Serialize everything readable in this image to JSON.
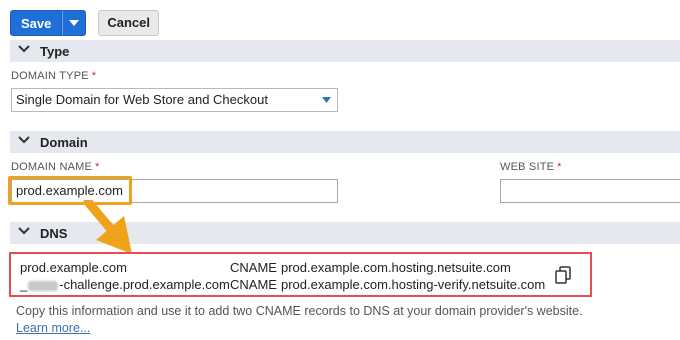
{
  "toolbar": {
    "save_label": "Save",
    "cancel_label": "Cancel"
  },
  "sections": {
    "type": "Type",
    "domain": "Domain",
    "dns": "DNS"
  },
  "type_section": {
    "domain_type_label": "DOMAIN TYPE",
    "required_mark": "*",
    "domain_type_value": "Single Domain for Web Store and Checkout"
  },
  "domain_section": {
    "domain_name_label": "DOMAIN NAME",
    "domain_name_value": "prod.example.com",
    "web_site_label": "WEB SITE",
    "web_site_value": ""
  },
  "dns_section": {
    "records": [
      {
        "host": "prod.example.com",
        "type": "CNAME",
        "target": "prod.example.com.hosting.netsuite.com"
      },
      {
        "host_prefix": "_",
        "host_suffix": "-challenge.prod.example.com",
        "type": "CNAME",
        "target": "prod.example.com.hosting-verify.netsuite.com"
      }
    ],
    "info_text": "Copy this information and use it to add two CNAME records to DNS at your domain provider's website.",
    "learn_more": "Learn more..."
  },
  "colors": {
    "primary_button": "#1f6fd8",
    "highlight_orange": "#f0a21a",
    "highlight_red": "#e34f4f",
    "section_bar": "#e5e8ee"
  },
  "icons": [
    "chevron-down-icon",
    "dropdown-caret-icon",
    "copy-icon",
    "arrow-annotation-icon"
  ]
}
